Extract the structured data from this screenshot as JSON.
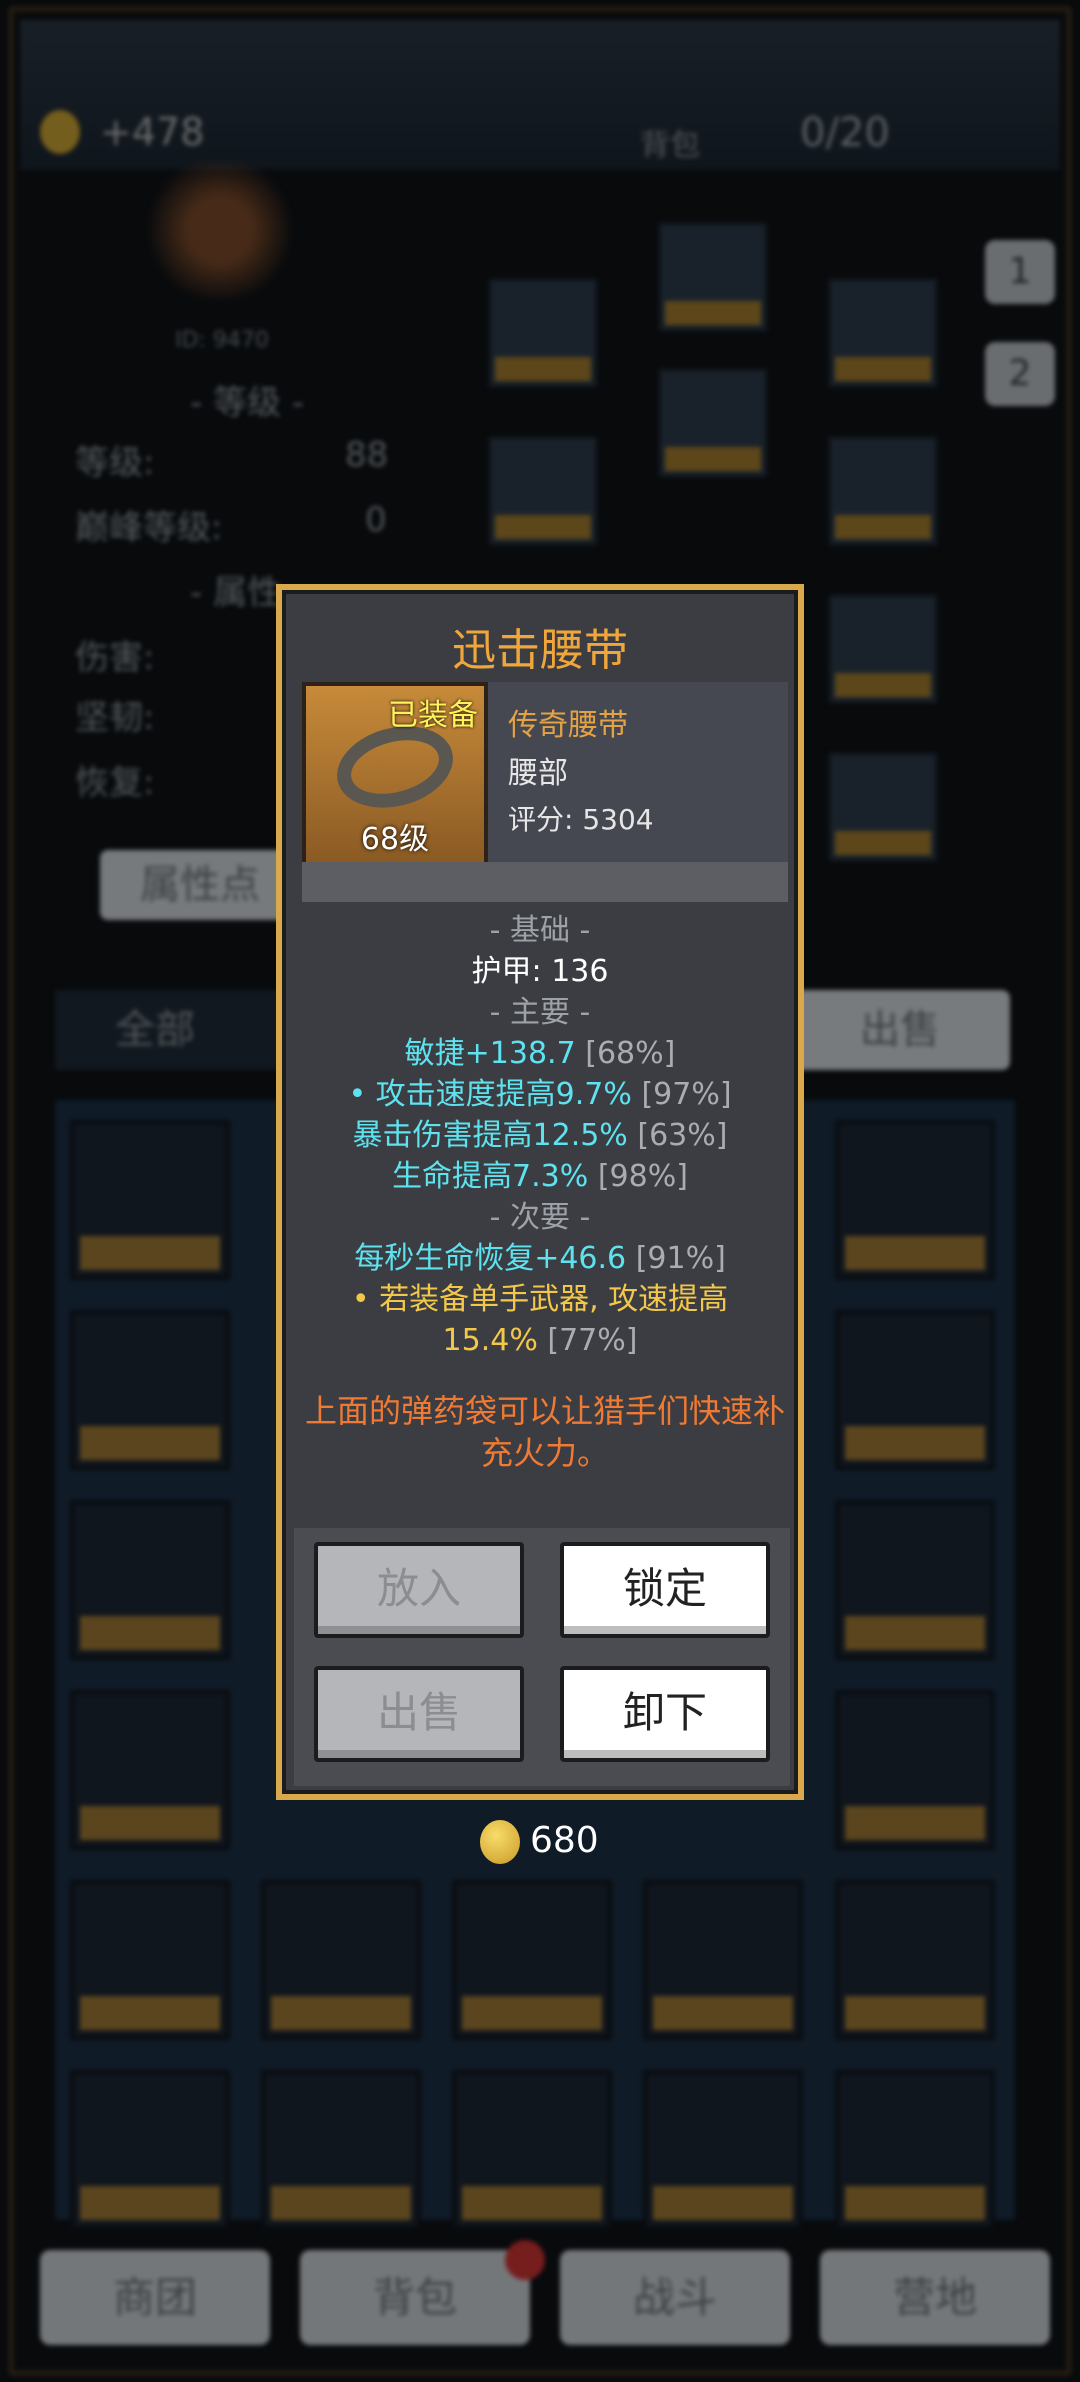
{
  "background": {
    "gold": "+478",
    "slots_label": "背包",
    "slots": "0/20",
    "id_text": "ID: 9470",
    "level_header": "- 等级 -",
    "stats": [
      {
        "label": "等级:",
        "value": "88"
      },
      {
        "label": "巅峰等级:",
        "value": "0"
      }
    ],
    "attr_header": "- 属性",
    "attr_labels": [
      "伤害:",
      "坚韧:",
      "恢复:"
    ],
    "attr_button": "属性点",
    "side_tabs": [
      "1",
      "2"
    ],
    "filter": "全部",
    "sell_button": "出售",
    "nav": [
      "商团",
      "背包",
      "战斗",
      "营地"
    ]
  },
  "modal": {
    "title": "迅击腰带",
    "equipped_tag": "已装备",
    "level_tag": "68级",
    "quality": "传奇腰带",
    "slot": "腰部",
    "score": "评分: 5304",
    "sections": {
      "base": "- 基础 -",
      "main": "- 主要 -",
      "secondary": "- 次要 -"
    },
    "base_stat": "护甲: 136",
    "main_stats": [
      {
        "text": "敏捷+138.7",
        "pct": "[68%]"
      },
      {
        "text": "• 攻击速度提高9.7%",
        "pct": "[97%]"
      },
      {
        "text": "暴击伤害提高12.5%",
        "pct": "[63%]"
      },
      {
        "text": "生命提高7.3%",
        "pct": "[98%]"
      }
    ],
    "secondary_stats": [
      {
        "text": "每秒生命恢复+46.6",
        "pct": "[91%]"
      }
    ],
    "special_line1": "• 若装备单手武器, 攻速提高",
    "special_line2": "15.4%",
    "special_pct": "[77%]",
    "description": "上面的弹药袋可以让猎手们快速补充火力。",
    "buttons": {
      "put_in": "放入",
      "lock": "锁定",
      "sell": "出售",
      "unequip": "卸下"
    },
    "price": "680"
  },
  "colors": {
    "title": "#f0a63b",
    "main_stat": "#5fe2ef",
    "special_stat": "#f3c84a",
    "description": "#f07a33",
    "border": "#d9a94b"
  }
}
